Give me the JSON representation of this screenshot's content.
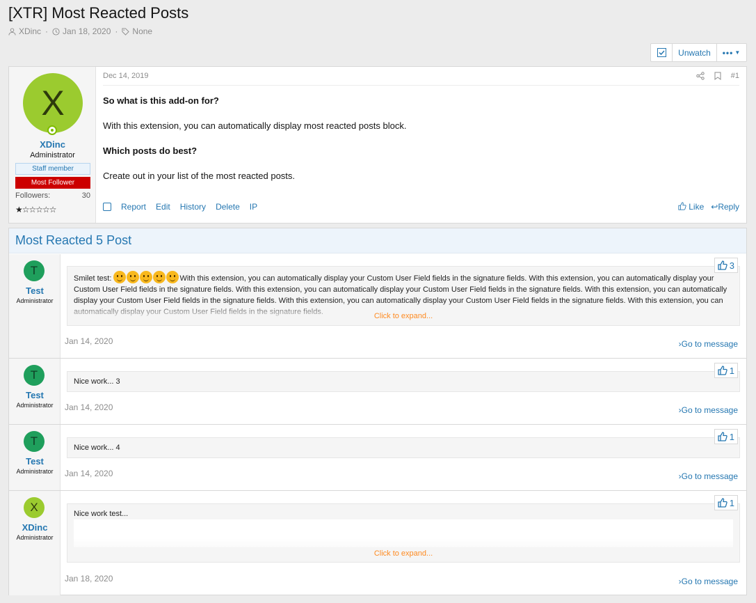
{
  "thread": {
    "title": "[XTR] Most Reacted Posts",
    "author": "XDinc",
    "date": "Jan 18, 2020",
    "tags": "None",
    "sep": "·"
  },
  "actions": {
    "unwatch": "Unwatch",
    "more": "•••"
  },
  "first_post": {
    "user": {
      "avatar_letter": "X",
      "name": "XDinc",
      "title": "Administrator",
      "staff_badge": "Staff member",
      "follower_badge": "Most Follower",
      "followers_label": "Followers:",
      "followers_count": "30",
      "stars": "★☆☆☆☆☆"
    },
    "date": "Dec 14, 2019",
    "number": "#1",
    "heading1": "So what is this add-on for?",
    "para1": "With this extension, you can automatically display most reacted posts block.",
    "heading2": "Which posts do best?",
    "para2": "Create out in your list of the most reacted posts.",
    "footer": {
      "report": "Report",
      "edit": "Edit",
      "history": "History",
      "delete": "Delete",
      "ip": "IP",
      "like": "Like",
      "reply": "Reply"
    }
  },
  "block": {
    "title": "Most Reacted 5 Post",
    "go_to_message": "Go to message",
    "click_to_expand": "Click to expand...",
    "rows": [
      {
        "avatar_letter": "T",
        "name": "Test",
        "title": "Administrator",
        "reactions": "3",
        "text_prefix": "Smilet test: ",
        "text": "With this extension, you can automatically display your Custom User Field fields in the signature fields. With this extension, you can automatically display your Custom User Field fields in the signature fields. With this extension, you can automatically display your Custom User Field fields in the signature fields. With this extension, you can automatically display your Custom User Field fields in the signature fields. With this extension, you can automatically display your Custom User Field fields in the signature fields. With this extension, you can automatically display your Custom User Field fields in the signature fields.",
        "date": "Jan 14, 2020"
      },
      {
        "avatar_letter": "T",
        "name": "Test",
        "title": "Administrator",
        "reactions": "1",
        "text": "Nice work... 3",
        "date": "Jan 14, 2020"
      },
      {
        "avatar_letter": "T",
        "name": "Test",
        "title": "Administrator",
        "reactions": "1",
        "text": "Nice work... 4",
        "date": "Jan 14, 2020"
      },
      {
        "avatar_letter": "X",
        "name": "XDinc",
        "title": "Administrator",
        "reactions": "1",
        "text": "Nice work test...",
        "date": "Jan 18, 2020"
      }
    ]
  },
  "colors": {
    "link": "#2577b1",
    "accent_orange": "#fe8b22",
    "badge_red": "#cc0000",
    "avatar_lime": "#9bcb2f",
    "avatar_green": "#1f9f5c"
  }
}
